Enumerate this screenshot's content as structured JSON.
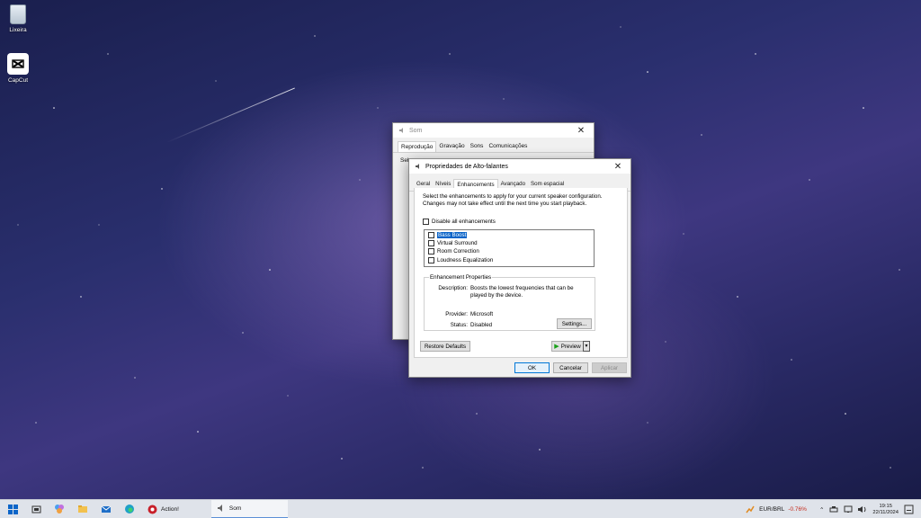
{
  "desktop": {
    "icons": [
      {
        "label": "Lixeira"
      },
      {
        "label": "CapCut"
      }
    ]
  },
  "som_window": {
    "title": "Som",
    "tabs": [
      "Reprodução",
      "Gravação",
      "Sons",
      "Comunicações"
    ],
    "partial_text": "Sele"
  },
  "properties_window": {
    "title": "Propriedades de Alto-falantes",
    "tabs": [
      "Geral",
      "Níveis",
      "Enhancements",
      "Avançado",
      "Som espacial"
    ],
    "active_tab": "Enhancements",
    "description": "Select the enhancements to apply for your current speaker configuration. Changes may not take effect until the next time you start playback.",
    "disable_all_label": "Disable all enhancements",
    "enhancements": [
      "Bass Boost",
      "Virtual Surround",
      "Room Correction",
      "Loudness Equalization"
    ],
    "selected_enhancement": "Bass Boost",
    "properties_legend": "Enhancement Properties",
    "description_key": "Description:",
    "description_value": "Boosts the lowest frequencies that can be played by the device.",
    "provider_key": "Provider:",
    "provider_value": "Microsoft",
    "status_key": "Status:",
    "status_value": "Disabled",
    "settings_button": "Settings...",
    "restore_button": "Restore Defaults",
    "preview_button": "Preview",
    "ok_button": "OK",
    "cancel_button": "Cancelar",
    "apply_button": "Aplicar"
  },
  "taskbar": {
    "apps": [
      {
        "label": "Action!"
      },
      {
        "label": "Som"
      }
    ],
    "ticker_symbol": "EUR/BRL",
    "ticker_change": "-0.76%",
    "time": "19:15",
    "date": "22/11/2024"
  },
  "colors": {
    "accent": "#0078d7",
    "selection": "#0a64c8",
    "ticker_negative": "#c42b1c"
  }
}
